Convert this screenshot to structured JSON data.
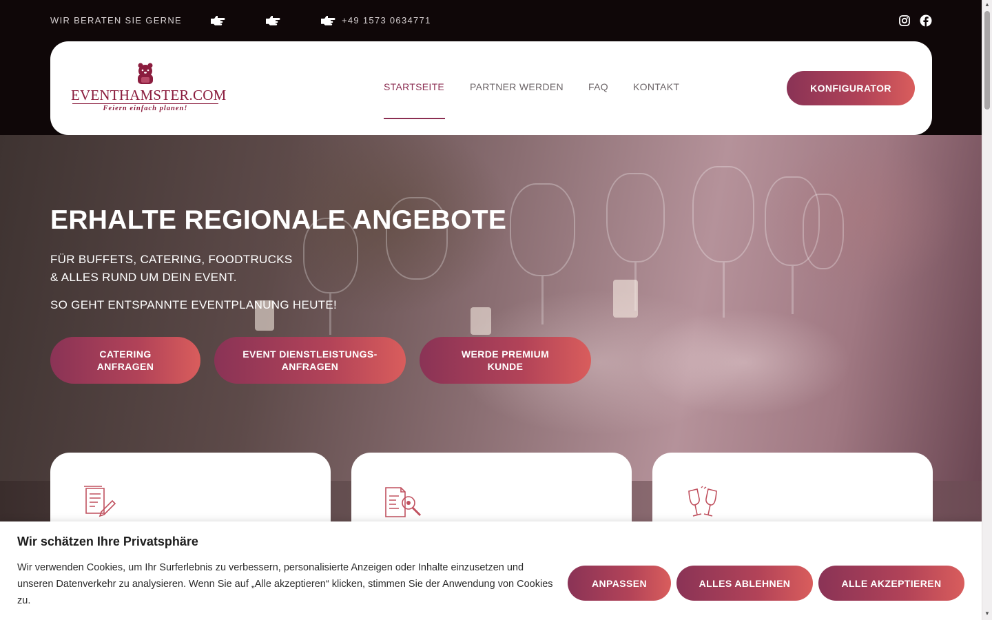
{
  "topbar": {
    "contact_label": "WIR BERATEN SIE GERNE",
    "phone": "+49 1573 0634771",
    "icons": [
      "pointing-hand-icon",
      "pointing-hand-icon",
      "pointing-hand-icon",
      "instagram-icon",
      "facebook-icon"
    ]
  },
  "header": {
    "logo": {
      "name": "EVENTHAMSTER.COM",
      "tagline": "Feiern einfach planen!"
    },
    "nav": [
      {
        "label": "STARTSEITE",
        "active": true
      },
      {
        "label": "PARTNER WERDEN",
        "active": false
      },
      {
        "label": "FAQ",
        "active": false
      },
      {
        "label": "KONTAKT",
        "active": false
      }
    ],
    "cta_label": "KONFIGURATOR"
  },
  "hero": {
    "title": "ERHALTE REGIONALE ANGEBOTE",
    "line1": "FÜR BUFFETS, CATERING, FOODTRUCKS",
    "line2": "& ALLES RUND UM DEIN EVENT.",
    "line3": "SO GEHT ENTSPANNTE EVENTPLANUNG HEUTE!",
    "buttons": [
      {
        "line1": "CATERING",
        "line2": "ANFRAGEN"
      },
      {
        "line1": "EVENT DIENSTLEISTUNGS-",
        "line2": "ANFRAGEN"
      },
      {
        "line1": "WERDE PREMIUM",
        "line2": "KUNDE"
      }
    ]
  },
  "cards": [
    {
      "icon": "document-pen-icon"
    },
    {
      "icon": "document-search-icon"
    },
    {
      "icon": "champagne-glasses-icon"
    }
  ],
  "cookie": {
    "title": "Wir schätzen Ihre Privatsphäre",
    "text": "Wir verwenden Cookies, um Ihr Surferlebnis zu verbessern, personalisierte Anzeigen oder Inhalte einzusetzen und unseren Datenverkehr zu analysieren. Wenn Sie auf „Alle akzeptieren“ klicken, stimmen Sie der Anwendung von Cookies zu.",
    "buttons": {
      "customize": "ANPASSEN",
      "reject": "ALLES ABLEHNEN",
      "accept": "ALLE AKZEPTIEREN"
    }
  },
  "colors": {
    "brand": "#8b1d3e",
    "accent_start": "#8a3356",
    "accent_end": "#d95d5c",
    "topbar_bg": "#0f0708"
  }
}
